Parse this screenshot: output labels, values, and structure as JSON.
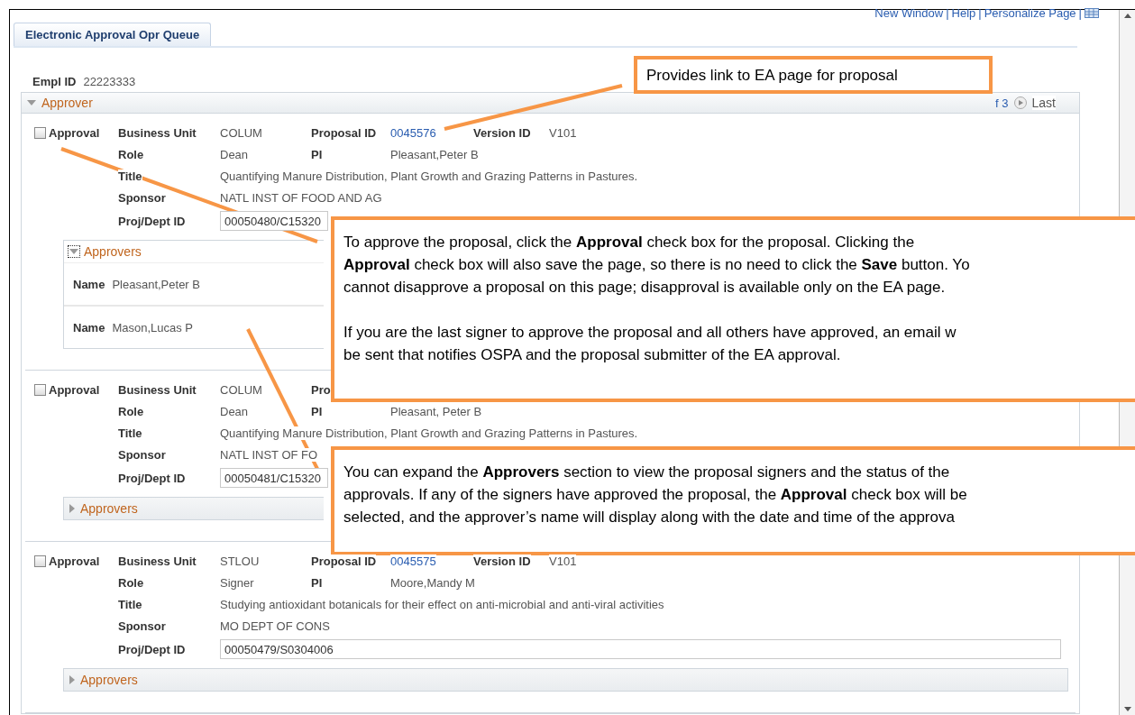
{
  "header_links": [
    "New Window",
    "Help",
    "Personalize Page"
  ],
  "link_separator": "|",
  "tabs": [
    {
      "label": "Electronic Approval Opr Queue",
      "selected": true
    }
  ],
  "empl_id": {
    "label": "Empl ID",
    "value": "22223333"
  },
  "section": {
    "title": "Approver",
    "expanded": true,
    "nav_count": "f 3",
    "nav_last": "Last"
  },
  "records": [
    {
      "approval": {
        "label": "Approval",
        "checked": false
      },
      "rows": [
        [
          {
            "label": "Business Unit",
            "value": "COLUM",
            "kind": "text"
          },
          {
            "label": "Proposal ID",
            "value": "0045576",
            "kind": "link"
          },
          {
            "label": "Version ID",
            "value": "V101",
            "kind": "text"
          }
        ],
        [
          {
            "label": "Role",
            "value": "Dean",
            "kind": "text"
          },
          {
            "label": "PI",
            "value": "Pleasant,Peter B",
            "kind": "text"
          }
        ],
        [
          {
            "label": "Title",
            "value": "Quantifying Manure Distribution, Plant Growth and Grazing Patterns in Pastures.",
            "kind": "text"
          }
        ],
        [
          {
            "label": "Sponsor",
            "value": "NATL INST OF FOOD AND AG",
            "kind": "text"
          }
        ],
        [
          {
            "label": "Proj/Dept ID",
            "value": "00050480/C15320",
            "kind": "input"
          }
        ]
      ],
      "approvers": {
        "label": "Approvers",
        "expanded": true,
        "names": [
          {
            "label": "Name",
            "value": "Pleasant,Peter B"
          },
          {
            "label": "Name",
            "value": "Mason,Lucas P"
          }
        ]
      }
    },
    {
      "approval": {
        "label": "Approval",
        "checked": false
      },
      "rows": [
        [
          {
            "label": "Business Unit",
            "value": "COLUM",
            "kind": "text"
          },
          {
            "label": "Pro"
          }
        ],
        [
          {
            "label": "Role",
            "value": "Dean",
            "kind": "text"
          },
          {
            "label": "PI",
            "value": "Pleasant, Peter B",
            "kind": "text"
          }
        ],
        [
          {
            "label": "Title",
            "value": "Quantifying Manure Distribution, Plant Growth and Grazing Patterns in Pastures.",
            "kind": "text"
          }
        ],
        [
          {
            "label": "Sponsor",
            "value": "NATL INST OF FO",
            "kind": "text"
          }
        ],
        [
          {
            "label": "Proj/Dept ID",
            "value": "00050481/C15320",
            "kind": "input"
          }
        ]
      ],
      "approvers": {
        "label": "Approvers",
        "expanded": false
      }
    },
    {
      "approval": {
        "label": "Approval",
        "checked": false
      },
      "rows": [
        [
          {
            "label": "Business Unit",
            "value": "STLOU",
            "kind": "text"
          },
          {
            "label": "Proposal ID",
            "value": "0045575",
            "kind": "link"
          },
          {
            "label": "Version ID",
            "value": "V101",
            "kind": "text"
          }
        ],
        [
          {
            "label": "Role",
            "value": "Signer",
            "kind": "text"
          },
          {
            "label": "PI",
            "value": "Moore,Mandy M",
            "kind": "text"
          }
        ],
        [
          {
            "label": "Title",
            "value": "Studying antioxidant botanicals for their effect on anti-microbial and anti-viral activities",
            "kind": "text"
          }
        ],
        [
          {
            "label": "Sponsor",
            "value": "MO DEPT OF CONS",
            "kind": "text"
          }
        ],
        [
          {
            "label": "Proj/Dept ID",
            "value": "00050479/S0304006",
            "kind": "input"
          }
        ]
      ],
      "approvers": {
        "label": "Approvers",
        "expanded": false
      }
    }
  ],
  "callouts": [
    {
      "paragraphs": [
        [
          "Provides link to EA page for proposal"
        ]
      ]
    },
    {
      "paragraphs": [
        [
          "To approve the proposal, click the **Approval** check box for the proposal. Clicking the",
          "**Approval** check box will also save the page, so there is no need to click the **Save** button. Yo",
          "cannot disapprove a proposal on this page; disapproval is available only on the EA page."
        ],
        [
          "If you are the last signer to approve the proposal and all others have approved, an email w",
          "be sent that notifies OSPA and the proposal submitter of the EA approval."
        ]
      ]
    },
    {
      "paragraphs": [
        [
          "You can expand the **Approvers** section to view the proposal signers and the status of the",
          "approvals. If any of the signers have approved the proposal, the **Approval** check box will be",
          "selected, and the approver’s name will display along with the date and time of the approva"
        ]
      ]
    }
  ]
}
